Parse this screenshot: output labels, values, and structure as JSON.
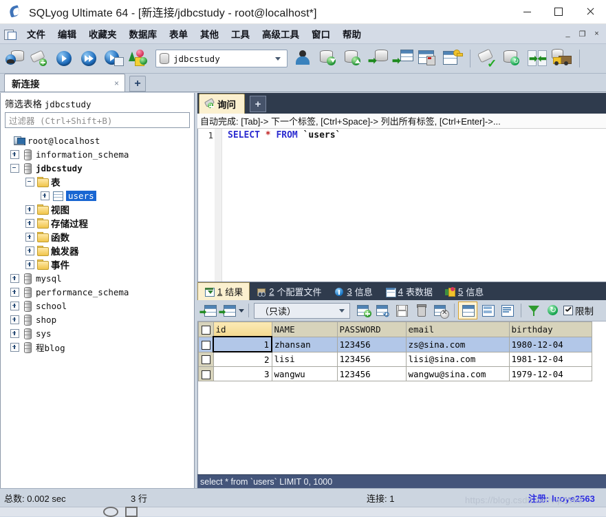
{
  "window": {
    "title": "SQLyog Ultimate 64 - [新连接/jdbcstudy - root@localhost*]",
    "app_icon": "sqlyog-logo-icon",
    "minimize": "—",
    "maximize": "□",
    "close": "✕"
  },
  "menubar": {
    "items": [
      "文件",
      "编辑",
      "收藏夹",
      "数据库",
      "表单",
      "其他",
      "工具",
      "高级工具",
      "窗口",
      "帮助"
    ],
    "mdi_minimize": "_",
    "mdi_restore": "❐",
    "mdi_close": "×"
  },
  "toolbar": {
    "db_selector": {
      "value": "jdbcstudy",
      "icon": "database-icon",
      "caret": "chevron-down-icon"
    },
    "buttons": [
      "new-connection-icon",
      "new-query-tab-icon",
      "execute-query-icon",
      "execute-all-queries-icon",
      "execute-query-new-tab-icon",
      "refresh-objects-icon",
      "user-manager-icon",
      "backup-database-icon",
      "restore-database-icon",
      "import-external-data-icon",
      "export-as-csv-icon",
      "table-diagnostics-icon",
      "manage-indexes-icon",
      "sql-formatter-icon",
      "schema-sync-icon",
      "data-sync-icon",
      "migration-icon"
    ]
  },
  "connection_tabs": {
    "tabs": [
      {
        "label": "新连接",
        "close": "×",
        "active": true
      }
    ],
    "add_label": "+"
  },
  "sidebar": {
    "filter_title_prefix": "筛选表格",
    "filter_title_db": "jdbcstudy",
    "filter_placeholder": "过滤器 (Ctrl+Shift+B)",
    "tree": [
      {
        "label": "root@localhost",
        "icon": "server-icon",
        "indent": 0,
        "expander": "none",
        "style": "mono"
      },
      {
        "label": "information_schema",
        "icon": "database-icon",
        "indent": 1,
        "expander": "plus",
        "style": "mono"
      },
      {
        "label": "jdbcstudy",
        "icon": "database-icon",
        "indent": 1,
        "expander": "minus",
        "style": "mono-bold"
      },
      {
        "label": "表",
        "icon": "folder-icon",
        "indent": 2,
        "expander": "minus",
        "style": "cjk"
      },
      {
        "label": "users",
        "icon": "table-icon",
        "indent": 3,
        "expander": "plus",
        "style": "mono-selected"
      },
      {
        "label": "视图",
        "icon": "folder-icon",
        "indent": 2,
        "expander": "plus",
        "style": "cjk"
      },
      {
        "label": "存储过程",
        "icon": "folder-icon",
        "indent": 2,
        "expander": "plus",
        "style": "cjk"
      },
      {
        "label": "函数",
        "icon": "folder-icon",
        "indent": 2,
        "expander": "plus",
        "style": "cjk"
      },
      {
        "label": "触发器",
        "icon": "folder-icon",
        "indent": 2,
        "expander": "plus",
        "style": "cjk"
      },
      {
        "label": "事件",
        "icon": "folder-icon",
        "indent": 2,
        "expander": "plus",
        "style": "cjk"
      },
      {
        "label": "mysql",
        "icon": "database-icon",
        "indent": 1,
        "expander": "plus",
        "style": "mono"
      },
      {
        "label": "performance_schema",
        "icon": "database-icon",
        "indent": 1,
        "expander": "plus",
        "style": "mono"
      },
      {
        "label": "school",
        "icon": "database-icon",
        "indent": 1,
        "expander": "plus",
        "style": "mono"
      },
      {
        "label": "shop",
        "icon": "database-icon",
        "indent": 1,
        "expander": "plus",
        "style": "mono"
      },
      {
        "label": "sys",
        "icon": "database-icon",
        "indent": 1,
        "expander": "plus",
        "style": "mono"
      },
      {
        "label": "程blog",
        "icon": "database-icon",
        "indent": 1,
        "expander": "plus",
        "style": "mono"
      }
    ]
  },
  "query_area": {
    "tab_label": "询问",
    "add_tab_label": "+",
    "autocomplete_hint": "自动完成: [Tab]-> 下一个标签, [Ctrl+Space]-> 列出所有标签, [Ctrl+Enter]->...",
    "line_number": "1",
    "sql": {
      "keyword1": "SELECT",
      "star": "*",
      "keyword2": "FROM",
      "table": "`users`"
    }
  },
  "results": {
    "tabs": [
      {
        "num": "1",
        "label": "结果",
        "icon": "result-grid-icon",
        "active": true
      },
      {
        "num": "2",
        "label": "个配置文件",
        "icon": "profile-icon",
        "active": false
      },
      {
        "num": "3",
        "label": "信息",
        "icon": "info-icon",
        "active": false
      },
      {
        "num": "4",
        "label": "表数据",
        "icon": "table-data-icon",
        "active": false
      },
      {
        "num": "5",
        "label": "信息",
        "icon": "objects-info-icon",
        "active": false
      }
    ],
    "toolbar": {
      "mode_select_value": "（只读）",
      "limit_label": "限制",
      "limit_checked": true,
      "buttons": [
        "grid-view-icon",
        "grid-options-icon",
        "insert-row-icon",
        "duplicate-row-icon",
        "save-changes-icon",
        "delete-row-icon",
        "cancel-changes-icon",
        "grid-layout-icon",
        "form-layout-icon",
        "text-layout-icon",
        "filter-icon",
        "refresh-icon"
      ]
    },
    "columns": [
      "id",
      "NAME",
      "PASSWORD",
      "email",
      "birthday"
    ],
    "rows": [
      {
        "id": "1",
        "NAME": "zhansan",
        "PASSWORD": "123456",
        "email": "zs@sina.com",
        "birthday": "1980-12-04",
        "selected": true
      },
      {
        "id": "2",
        "NAME": "lisi",
        "PASSWORD": "123456",
        "email": "lisi@sina.com",
        "birthday": "1981-12-04",
        "selected": false
      },
      {
        "id": "3",
        "NAME": "wangwu",
        "PASSWORD": "123456",
        "email": "wangwu@sina.com",
        "birthday": "1979-12-04",
        "selected": false
      }
    ],
    "executed_query": "select * from `users` LIMIT 0, 1000"
  },
  "statusbar": {
    "total_time": "总数: 0.002 sec",
    "row_count": "3 行",
    "connections": "连接: 1",
    "register": "注册: luoye2563",
    "watermark": "https://blog.csdn.net/vip2563"
  },
  "colors": {
    "accent_blue": "#1966d2",
    "tab_active": "#fbf0cf",
    "dark_tabstrip": "#2f3b4d",
    "toolbar_bg": "#ccd5e0",
    "grid_header": "#d7d3bb",
    "row_selected": "#b2c7e8"
  }
}
